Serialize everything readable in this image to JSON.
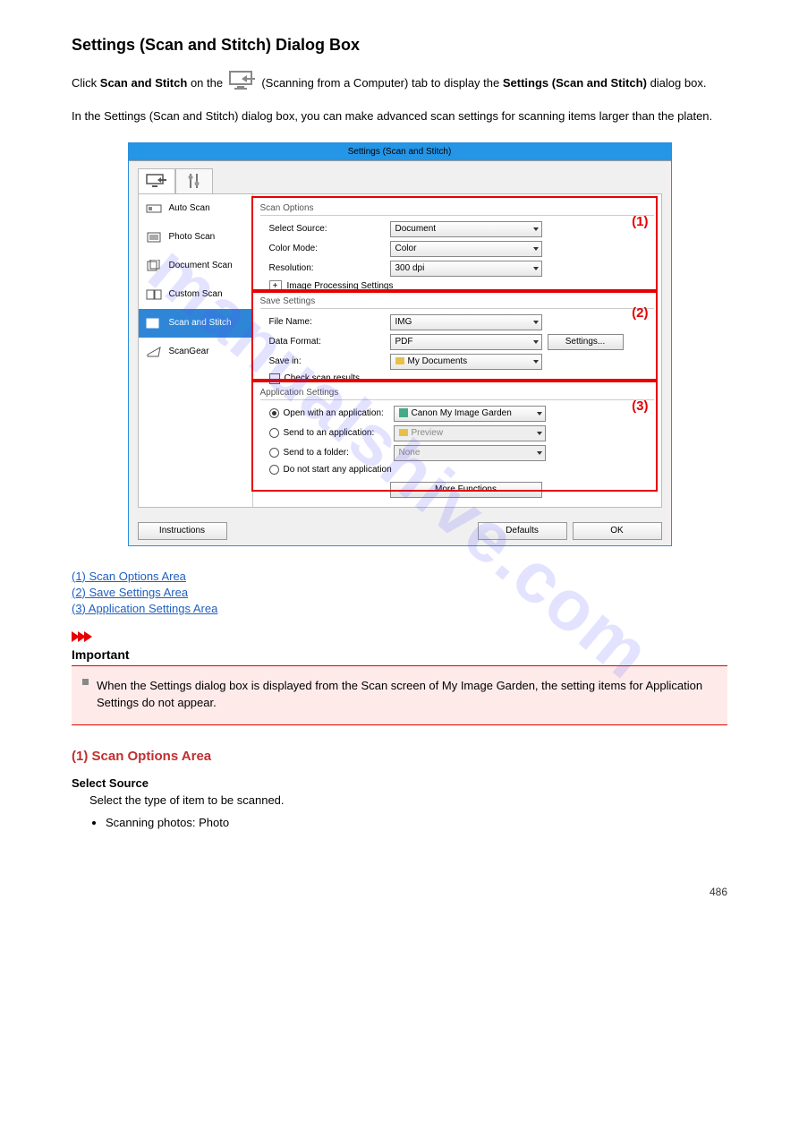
{
  "heading": "Settings (Scan and Stitch) Dialog Box",
  "intro_a": "Click ",
  "intro_b": "Scan and Stitch",
  "intro_c": " on the ",
  "intro_d": " (Scanning from a Computer) tab to display the ",
  "intro_e": "Settings (Scan and Stitch)",
  "intro_f": " dialog box.",
  "paragraph2": "In the Settings (Scan and Stitch) dialog box, you can make advanced scan settings for scanning items larger than the platen.",
  "dialog": {
    "title": "Settings (Scan and Stitch)",
    "sidebar": [
      {
        "label": "Auto Scan"
      },
      {
        "label": "Photo Scan"
      },
      {
        "label": "Document Scan"
      },
      {
        "label": "Custom Scan"
      },
      {
        "label": "Scan and Stitch"
      },
      {
        "label": "ScanGear"
      }
    ],
    "group1": "Scan Options",
    "select_source": "Select Source:",
    "select_source_val": "Document",
    "color_mode": "Color Mode:",
    "color_mode_val": "Color",
    "resolution": "Resolution:",
    "resolution_val": "300 dpi",
    "img_proc": "Image Processing Settings",
    "group2": "Save Settings",
    "file_name": "File Name:",
    "file_name_val": "IMG",
    "data_format": "Data Format:",
    "data_format_val": "PDF",
    "settings_btn": "Settings...",
    "save_in": "Save in:",
    "save_in_val": "My Documents",
    "check_results": "Check scan results",
    "group3": "Application Settings",
    "open_app": "Open with an application:",
    "open_app_val": "Canon My Image Garden",
    "send_app": "Send to an application:",
    "send_app_val": "Preview",
    "send_folder": "Send to a folder:",
    "send_folder_val": "None",
    "no_app": "Do not start any application",
    "more_func": "More Functions",
    "footer": {
      "instructions": "Instructions",
      "defaults": "Defaults",
      "ok": "OK"
    },
    "labels_r": {
      "l1": "(1)",
      "l2": "(2)",
      "l3": "(3)"
    }
  },
  "links": {
    "l1": "(1) Scan Options Area",
    "l2": "(2) Save Settings Area",
    "l3": "(3) Application Settings Area"
  },
  "important_title": "Important",
  "important_text": "When the Settings dialog box is displayed from the Scan screen of My Image Garden, the setting items for Application Settings do not appear.",
  "subhead1": "(1) Scan Options Area",
  "field1": "Select Source",
  "field1_desc": "Select the type of item to be scanned.",
  "field1_li1": "Scanning photos: Photo",
  "page_num": "486"
}
